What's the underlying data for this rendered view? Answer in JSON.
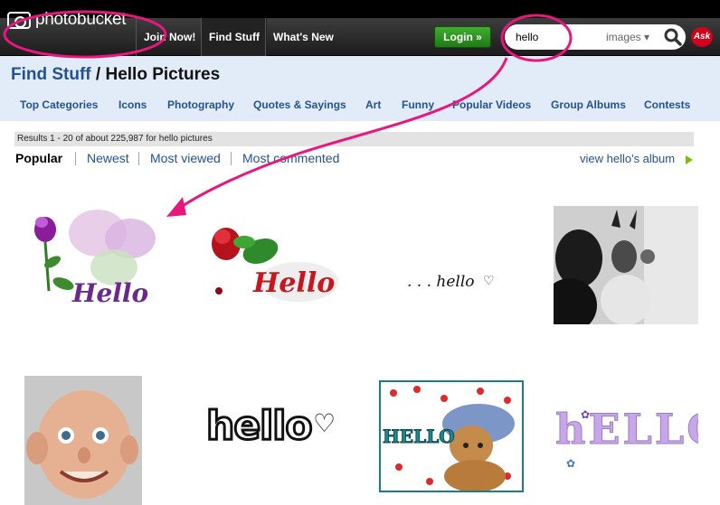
{
  "header": {
    "logo_text": "photobucket",
    "nav": [
      "Join Now!",
      "Find Stuff",
      "What's New"
    ],
    "login_label": "Login »",
    "search": {
      "value": "hello",
      "type": "images ▾"
    },
    "ask_label": "Ask"
  },
  "page": {
    "title_link": "Find Stuff",
    "title_rest": " / Hello Pictures"
  },
  "categories": [
    "Top Categories",
    "Icons",
    "Photography",
    "Quotes & Sayings",
    "Art",
    "Funny",
    "Popular Videos",
    "Group Albums",
    "Contests"
  ],
  "results_text": "Results 1 - 20 of about 225,987 for hello pictures",
  "sort_tabs": [
    "Popular",
    "Newest",
    "Most viewed",
    "Most commented"
  ],
  "album_link": "view hello's album",
  "thumbnails": {
    "t1_text": "Hello",
    "t2_text": "Hello",
    "t3_text": ". . . hello",
    "t6_text": "hello",
    "t7_text": "HELLO",
    "t8_text": "hELLO"
  },
  "colors": {
    "annotation": "#e8177e",
    "link": "#245291",
    "login": "#2a9320"
  }
}
